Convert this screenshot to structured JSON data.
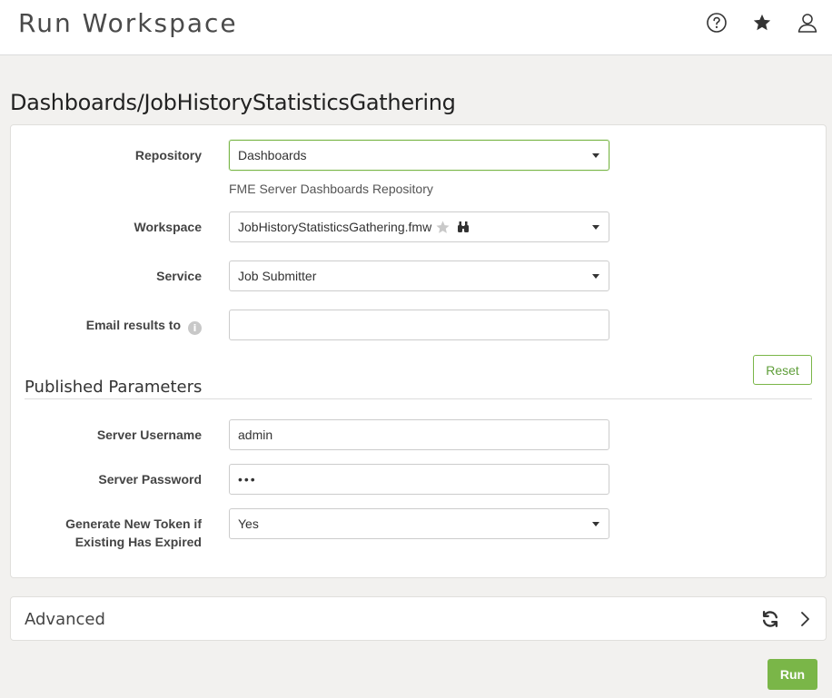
{
  "header": {
    "title": "Run Workspace",
    "icons": [
      "help-icon",
      "favorites-icon",
      "user-icon"
    ]
  },
  "page_title": "Dashboards/JobHistoryStatisticsGathering",
  "form": {
    "repository": {
      "label": "Repository",
      "value": "Dashboards",
      "help": "FME Server Dashboards Repository"
    },
    "workspace": {
      "label": "Workspace",
      "value": "JobHistoryStatisticsGathering.fmw"
    },
    "service": {
      "label": "Service",
      "value": "Job Submitter"
    },
    "email": {
      "label": "Email results to",
      "value": "",
      "placeholder": ""
    }
  },
  "reset_label": "Reset",
  "published_parameters": {
    "title": "Published Parameters",
    "server_username": {
      "label": "Server Username",
      "value": "admin"
    },
    "server_password": {
      "label": "Server Password",
      "value": "•••"
    },
    "generate_token": {
      "label_line1": "Generate New Token if",
      "label_line2": "Existing Has Expired",
      "value": "Yes"
    }
  },
  "advanced": {
    "label": "Advanced"
  },
  "run_label": "Run",
  "colors": {
    "accent": "#7ab648",
    "background": "#f2f1ef"
  }
}
